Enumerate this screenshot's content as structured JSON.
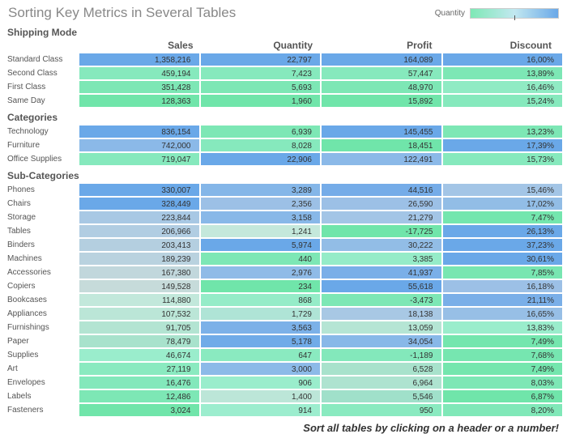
{
  "title": "Sorting Key Metrics in Several Tables",
  "legend_label": "Quantity",
  "footer": "Sort all tables by clicking on a header or a number!",
  "columns": [
    "Sales",
    "Quantity",
    "Profit",
    "Discount"
  ],
  "groups": [
    {
      "title": "Shipping Mode",
      "rows": [
        {
          "label": "Standard Class",
          "sales": "1,358,216",
          "quantity": "22,797",
          "profit": "164,089",
          "discount": "16,00%",
          "colors": [
            "#6aa8e8",
            "#6aa8e8",
            "#6aa8e8",
            "#6aa8e8"
          ]
        },
        {
          "label": "Second Class",
          "sales": "459,194",
          "quantity": "7,423",
          "profit": "57,447",
          "discount": "13,89%",
          "colors": [
            "#86e9bd",
            "#86e9bd",
            "#86e9bd",
            "#7de7b5"
          ]
        },
        {
          "label": "First Class",
          "sales": "351,428",
          "quantity": "5,693",
          "profit": "48,970",
          "discount": "16,46%",
          "colors": [
            "#7de7b5",
            "#7de7b5",
            "#7de7b5",
            "#90ebc4"
          ]
        },
        {
          "label": "Same Day",
          "sales": "128,363",
          "quantity": "1,960",
          "profit": "15,892",
          "discount": "15,24%",
          "colors": [
            "#70e5aa",
            "#70e5aa",
            "#70e5aa",
            "#86e9bd"
          ]
        }
      ]
    },
    {
      "title": "Categories",
      "rows": [
        {
          "label": "Technology",
          "sales": "836,154",
          "quantity": "6,939",
          "profit": "145,455",
          "discount": "13,23%",
          "colors": [
            "#6aa8e8",
            "#7de7b5",
            "#6aa8e8",
            "#7de7b5"
          ]
        },
        {
          "label": "Furniture",
          "sales": "742,000",
          "quantity": "8,028",
          "profit": "18,451",
          "discount": "17,39%",
          "colors": [
            "#8bb9e8",
            "#86e9bd",
            "#70e5aa",
            "#6aa8e8"
          ]
        },
        {
          "label": "Office Supplies",
          "sales": "719,047",
          "quantity": "22,906",
          "profit": "122,491",
          "discount": "15,73%",
          "colors": [
            "#86e9bd",
            "#6aa8e8",
            "#8bb9e8",
            "#86e9bd"
          ]
        }
      ]
    },
    {
      "title": "Sub-Categories",
      "rows": [
        {
          "label": "Phones",
          "sales": "330,007",
          "quantity": "3,289",
          "profit": "44,516",
          "discount": "15,46%",
          "colors": [
            "#6aa8e8",
            "#84b6e8",
            "#75ace8",
            "#a3c5e6"
          ]
        },
        {
          "label": "Chairs",
          "sales": "328,449",
          "quantity": "2,356",
          "profit": "26,590",
          "discount": "17,02%",
          "colors": [
            "#6aa8e8",
            "#9cc0e6",
            "#9cc0e6",
            "#92bde6"
          ]
        },
        {
          "label": "Storage",
          "sales": "223,844",
          "quantity": "3,158",
          "profit": "21,279",
          "discount": "7,47%",
          "colors": [
            "#a8c8e4",
            "#88b8e8",
            "#a3c5e6",
            "#74e6ae"
          ]
        },
        {
          "label": "Tables",
          "sales": "206,966",
          "quantity": "1,241",
          "profit": "-17,725",
          "discount": "26,13%",
          "colors": [
            "#b1cde2",
            "#c4e8db",
            "#70e5aa",
            "#6aa8e8"
          ]
        },
        {
          "label": "Binders",
          "sales": "203,413",
          "quantity": "5,974",
          "profit": "30,222",
          "discount": "37,23%",
          "colors": [
            "#b4cfe0",
            "#6aa8e8",
            "#92bde6",
            "#6aa8e8"
          ]
        },
        {
          "label": "Machines",
          "sales": "189,239",
          "quantity": "440",
          "profit": "3,385",
          "discount": "30,61%",
          "colors": [
            "#b9d2df",
            "#7de7b5",
            "#95ecc8",
            "#6aa8e8"
          ]
        },
        {
          "label": "Accessories",
          "sales": "167,380",
          "quantity": "2,976",
          "profit": "41,937",
          "discount": "7,85%",
          "colors": [
            "#c1d7dc",
            "#8fbbe7",
            "#7aafe8",
            "#78e6b1"
          ]
        },
        {
          "label": "Copiers",
          "sales": "149,528",
          "quantity": "234",
          "profit": "55,618",
          "discount": "16,18%",
          "colors": [
            "#c6dbda",
            "#70e5aa",
            "#6aa8e8",
            "#9cc0e6"
          ]
        },
        {
          "label": "Bookcases",
          "sales": "114,880",
          "quantity": "868",
          "profit": "-3,473",
          "discount": "21,11%",
          "colors": [
            "#c2e8db",
            "#95ecc8",
            "#7de7b5",
            "#7aafe8"
          ]
        },
        {
          "label": "Appliances",
          "sales": "107,532",
          "quantity": "1,729",
          "profit": "18,138",
          "discount": "16,65%",
          "colors": [
            "#bbe6d7",
            "#afe4d6",
            "#a8c8e4",
            "#97bfe6"
          ]
        },
        {
          "label": "Furnishings",
          "sales": "91,705",
          "quantity": "3,563",
          "profit": "13,059",
          "discount": "13,83%",
          "colors": [
            "#b3e4d2",
            "#7cb1e8",
            "#b5e5d4",
            "#9aedcc"
          ]
        },
        {
          "label": "Paper",
          "sales": "78,479",
          "quantity": "5,178",
          "profit": "34,054",
          "discount": "7,49%",
          "colors": [
            "#a8e2cc",
            "#70abe8",
            "#88b8e8",
            "#74e6ae"
          ]
        },
        {
          "label": "Supplies",
          "sales": "46,674",
          "quantity": "647",
          "profit": "-1,189",
          "discount": "7,68%",
          "colors": [
            "#9aedcc",
            "#8aeac0",
            "#83e8bb",
            "#76e6b0"
          ]
        },
        {
          "label": "Art",
          "sales": "27,119",
          "quantity": "3,000",
          "profit": "6,528",
          "discount": "7,49%",
          "colors": [
            "#8aeac0",
            "#8cbae8",
            "#a8e2cc",
            "#74e6ae"
          ]
        },
        {
          "label": "Envelopes",
          "sales": "16,476",
          "quantity": "906",
          "profit": "6,964",
          "discount": "8,03%",
          "colors": [
            "#83e8bb",
            "#9aedcc",
            "#aee3d0",
            "#7de7b5"
          ]
        },
        {
          "label": "Labels",
          "sales": "12,486",
          "quantity": "1,400",
          "profit": "5,546",
          "discount": "6,87%",
          "colors": [
            "#7de7b5",
            "#bce6d8",
            "#a0e0ca",
            "#70e5aa"
          ]
        },
        {
          "label": "Fasteners",
          "sales": "3,024",
          "quantity": "914",
          "profit": "950",
          "discount": "8,20%",
          "colors": [
            "#70e5aa",
            "#9cedce",
            "#8aeac0",
            "#80e8b8"
          ]
        }
      ]
    }
  ],
  "chart_data": {
    "type": "table",
    "title": "Sorting Key Metrics in Several Tables",
    "color_legend": "Quantity",
    "columns": [
      "Sales",
      "Quantity",
      "Profit",
      "Discount"
    ],
    "groups": {
      "Shipping Mode": [
        {
          "label": "Standard Class",
          "Sales": 1358216,
          "Quantity": 22797,
          "Profit": 164089,
          "Discount": 16.0
        },
        {
          "label": "Second Class",
          "Sales": 459194,
          "Quantity": 7423,
          "Profit": 57447,
          "Discount": 13.89
        },
        {
          "label": "First Class",
          "Sales": 351428,
          "Quantity": 5693,
          "Profit": 48970,
          "Discount": 16.46
        },
        {
          "label": "Same Day",
          "Sales": 128363,
          "Quantity": 1960,
          "Profit": 15892,
          "Discount": 15.24
        }
      ],
      "Categories": [
        {
          "label": "Technology",
          "Sales": 836154,
          "Quantity": 6939,
          "Profit": 145455,
          "Discount": 13.23
        },
        {
          "label": "Furniture",
          "Sales": 742000,
          "Quantity": 8028,
          "Profit": 18451,
          "Discount": 17.39
        },
        {
          "label": "Office Supplies",
          "Sales": 719047,
          "Quantity": 22906,
          "Profit": 122491,
          "Discount": 15.73
        }
      ],
      "Sub-Categories": [
        {
          "label": "Phones",
          "Sales": 330007,
          "Quantity": 3289,
          "Profit": 44516,
          "Discount": 15.46
        },
        {
          "label": "Chairs",
          "Sales": 328449,
          "Quantity": 2356,
          "Profit": 26590,
          "Discount": 17.02
        },
        {
          "label": "Storage",
          "Sales": 223844,
          "Quantity": 3158,
          "Profit": 21279,
          "Discount": 7.47
        },
        {
          "label": "Tables",
          "Sales": 206966,
          "Quantity": 1241,
          "Profit": -17725,
          "Discount": 26.13
        },
        {
          "label": "Binders",
          "Sales": 203413,
          "Quantity": 5974,
          "Profit": 30222,
          "Discount": 37.23
        },
        {
          "label": "Machines",
          "Sales": 189239,
          "Quantity": 440,
          "Profit": 3385,
          "Discount": 30.61
        },
        {
          "label": "Accessories",
          "Sales": 167380,
          "Quantity": 2976,
          "Profit": 41937,
          "Discount": 7.85
        },
        {
          "label": "Copiers",
          "Sales": 149528,
          "Quantity": 234,
          "Profit": 55618,
          "Discount": 16.18
        },
        {
          "label": "Bookcases",
          "Sales": 114880,
          "Quantity": 868,
          "Profit": -3473,
          "Discount": 21.11
        },
        {
          "label": "Appliances",
          "Sales": 107532,
          "Quantity": 1729,
          "Profit": 18138,
          "Discount": 16.65
        },
        {
          "label": "Furnishings",
          "Sales": 91705,
          "Quantity": 3563,
          "Profit": 13059,
          "Discount": 13.83
        },
        {
          "label": "Paper",
          "Sales": 78479,
          "Quantity": 5178,
          "Profit": 34054,
          "Discount": 7.49
        },
        {
          "label": "Supplies",
          "Sales": 46674,
          "Quantity": 647,
          "Profit": -1189,
          "Discount": 7.68
        },
        {
          "label": "Art",
          "Sales": 27119,
          "Quantity": 3000,
          "Profit": 6528,
          "Discount": 7.49
        },
        {
          "label": "Envelopes",
          "Sales": 16476,
          "Quantity": 906,
          "Profit": 6964,
          "Discount": 8.03
        },
        {
          "label": "Labels",
          "Sales": 12486,
          "Quantity": 1400,
          "Profit": 5546,
          "Discount": 6.87
        },
        {
          "label": "Fasteners",
          "Sales": 3024,
          "Quantity": 914,
          "Profit": 950,
          "Discount": 8.2
        }
      ]
    }
  }
}
